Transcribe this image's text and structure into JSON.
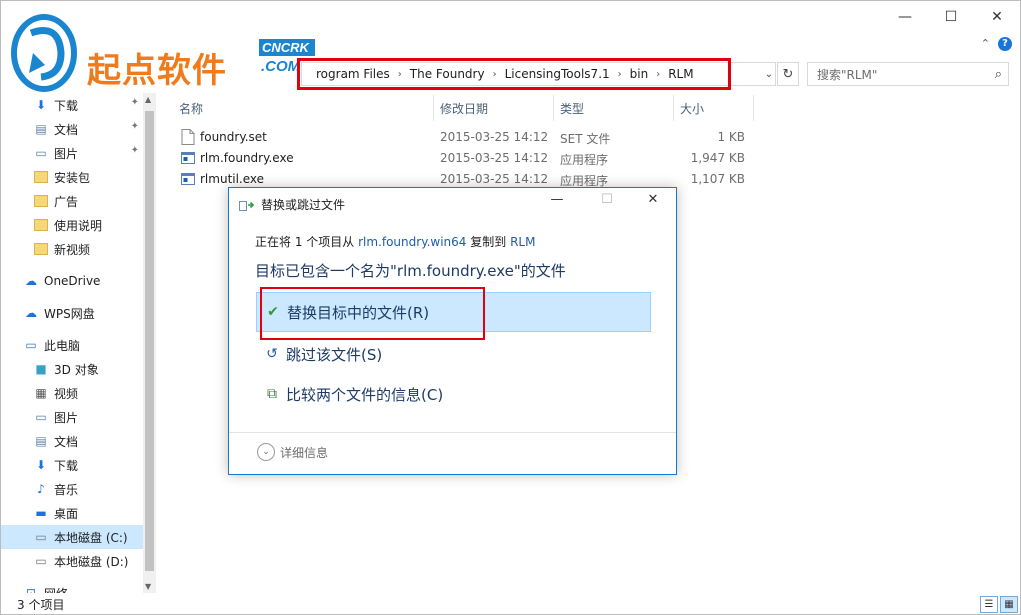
{
  "window": {
    "minimize_glyph": "—",
    "maximize_glyph": "☐",
    "close_glyph": "✕"
  },
  "logo": {
    "brand_text": "起点软件",
    "badge_top": "CNCRK",
    "badge_bottom": ".COM"
  },
  "address": {
    "partial_first": "rogram Files",
    "segments": [
      "The Foundry",
      "LicensingTools7.1",
      "bin",
      "RLM"
    ],
    "separator_glyph": "›",
    "dropdown_glyph": "⌄",
    "refresh_glyph": "↻"
  },
  "search": {
    "placeholder": "搜索\"RLM\"",
    "icon": "search-icon"
  },
  "nav": {
    "items": [
      {
        "label": "下载",
        "icon": "download-arrow-icon",
        "pinned": true
      },
      {
        "label": "文档",
        "icon": "document-icon",
        "pinned": true
      },
      {
        "label": "图片",
        "icon": "picture-icon",
        "pinned": true
      },
      {
        "label": "安装包",
        "icon": "folder-icon",
        "pinned": false
      },
      {
        "label": "广告",
        "icon": "folder-icon",
        "pinned": false
      },
      {
        "label": "使用说明",
        "icon": "folder-icon",
        "pinned": false
      },
      {
        "label": "新视频",
        "icon": "folder-icon",
        "pinned": false
      },
      {
        "label": "OneDrive",
        "icon": "cloud-icon",
        "pinned": false
      },
      {
        "label": "WPS网盘",
        "icon": "cloud-icon",
        "pinned": false
      },
      {
        "label": "此电脑",
        "icon": "computer-icon",
        "pinned": false
      },
      {
        "label": "3D 对象",
        "icon": "cube-icon",
        "pinned": false
      },
      {
        "label": "视频",
        "icon": "video-icon",
        "pinned": false
      },
      {
        "label": "图片",
        "icon": "picture-icon",
        "pinned": false
      },
      {
        "label": "文档",
        "icon": "document-icon",
        "pinned": false
      },
      {
        "label": "下载",
        "icon": "download-arrow-icon",
        "pinned": false
      },
      {
        "label": "音乐",
        "icon": "music-note-icon",
        "pinned": false
      },
      {
        "label": "桌面",
        "icon": "desktop-icon",
        "pinned": false
      },
      {
        "label": "本地磁盘 (C:)",
        "icon": "drive-icon",
        "pinned": false,
        "selected": true
      },
      {
        "label": "本地磁盘 (D:)",
        "icon": "drive-icon",
        "pinned": false
      },
      {
        "label": "网络",
        "icon": "network-icon",
        "pinned": false
      }
    ]
  },
  "columns": {
    "name": "名称",
    "date": "修改日期",
    "type": "类型",
    "size": "大小"
  },
  "files": [
    {
      "name": "foundry.set",
      "date": "2015-03-25 14:12",
      "type": "SET 文件",
      "size": "1 KB"
    },
    {
      "name": "rlm.foundry.exe",
      "date": "2015-03-25 14:12",
      "type": "应用程序",
      "size": "1,947 KB"
    },
    {
      "name": "rlmutil.exe",
      "date": "2015-03-25 14:12",
      "type": "应用程序",
      "size": "1,107 KB"
    }
  ],
  "status": {
    "count": "3 个项目"
  },
  "dialog": {
    "title": "替换或跳过文件",
    "line1_prefix": "正在将 1 个项目从 ",
    "line1_source": "rlm.foundry.win64",
    "line1_middle": " 复制到 ",
    "line1_dest": "RLM",
    "heading": "目标已包含一个名为\"rlm.foundry.exe\"的文件",
    "options": [
      {
        "label": "替换目标中的文件(R)",
        "icon": "checkmark-icon",
        "glyph": "✔",
        "color": "#2e9a3a",
        "highlighted": true
      },
      {
        "label": "跳过该文件(S)",
        "icon": "skip-arrow-icon",
        "glyph": "↺",
        "color": "#1c5dab",
        "highlighted": false
      },
      {
        "label": "比较两个文件的信息(C)",
        "icon": "compare-files-icon",
        "glyph": "⧉",
        "color": "#3a7a3a",
        "highlighted": false
      }
    ],
    "details": "详细信息",
    "minimize_glyph": "—",
    "maximize_glyph": "☐",
    "close_glyph": "✕"
  },
  "colors": {
    "highlight_red": "#e1000f",
    "selection_blue": "#cce8ff",
    "brand_orange": "#f07b1c",
    "brand_blue": "#1a86d0"
  }
}
